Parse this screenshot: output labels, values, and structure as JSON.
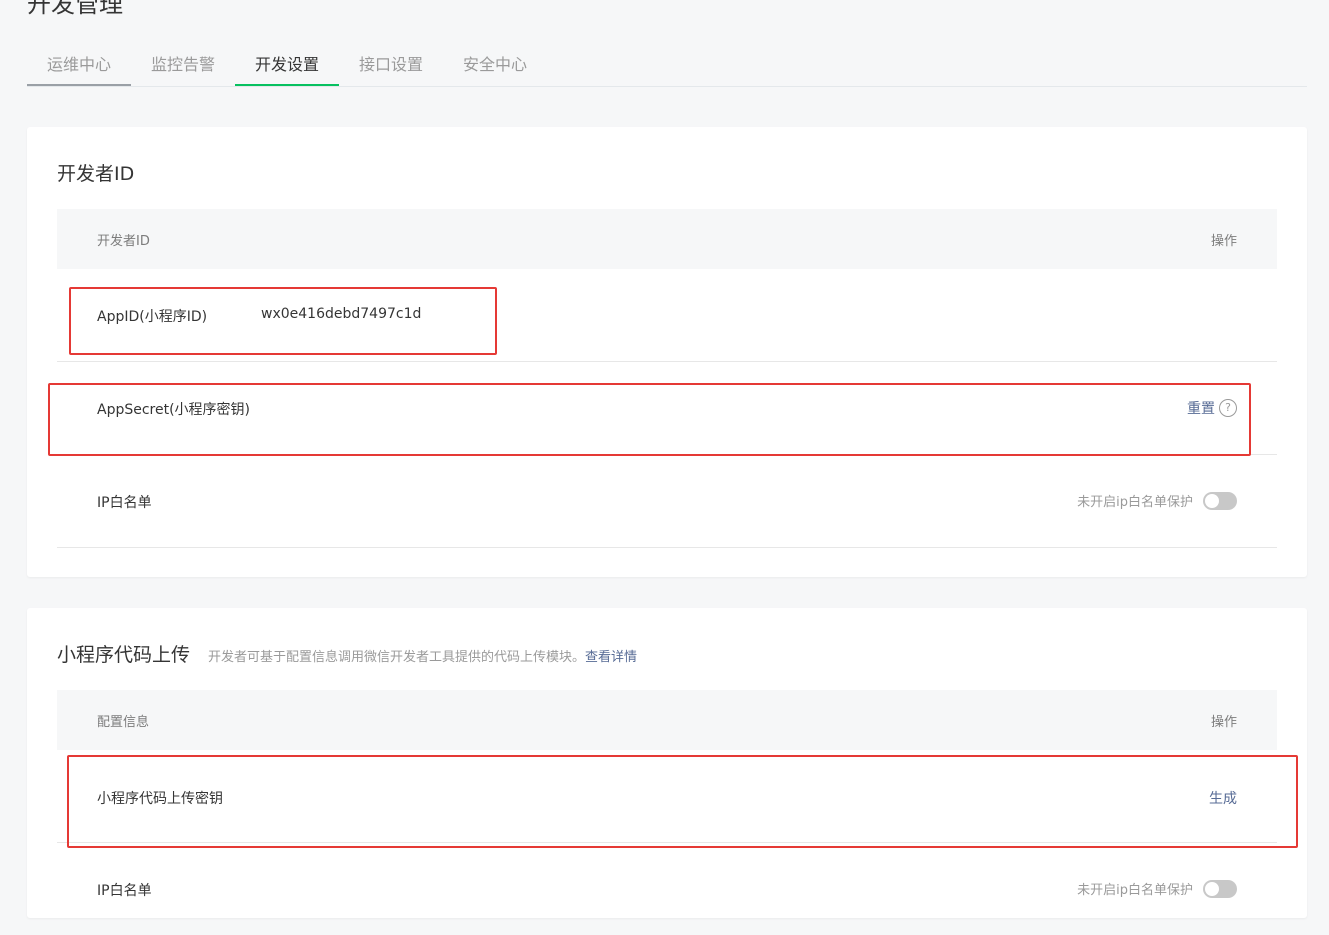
{
  "page": {
    "title": "开发管理"
  },
  "tabs": [
    {
      "label": "运维中心"
    },
    {
      "label": "监控告警"
    },
    {
      "label": "开发设置"
    },
    {
      "label": "接口设置"
    },
    {
      "label": "安全中心"
    }
  ],
  "dev_id_card": {
    "title": "开发者ID",
    "header": {
      "col1": "开发者ID",
      "col2": "操作"
    },
    "appid": {
      "label": "AppID(小程序ID)",
      "value": "wx0e416debd7497c1d"
    },
    "appsecret": {
      "label": "AppSecret(小程序密钥)",
      "action": "重置",
      "help": "?"
    },
    "ip_whitelist": {
      "label": "IP白名单",
      "status": "未开启ip白名单保护"
    }
  },
  "upload_card": {
    "title": "小程序代码上传",
    "desc": "开发者可基于配置信息调用微信开发者工具提供的代码上传模块。",
    "desc_link": "查看详情",
    "header": {
      "col1": "配置信息",
      "col2": "操作"
    },
    "upload_key": {
      "label": "小程序代码上传密钥",
      "action": "生成"
    },
    "ip_whitelist": {
      "label": "IP白名单",
      "status": "未开启ip白名单保护"
    }
  },
  "colors": {
    "accent": "#07c160",
    "link": "#576b95",
    "highlight": "#e53935"
  }
}
